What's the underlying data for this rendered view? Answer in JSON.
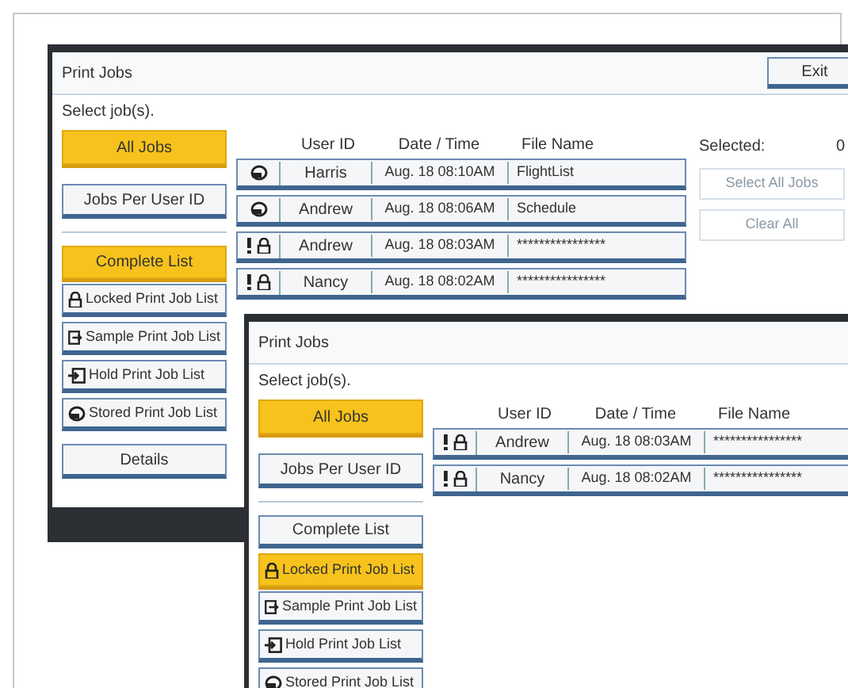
{
  "screens": [
    {
      "title": "Print Jobs",
      "exit": "Exit",
      "prompt": "Select job(s).",
      "view_buttons": [
        {
          "label": "All Jobs",
          "selected": true
        },
        {
          "label": "Jobs Per User ID",
          "selected": false
        }
      ],
      "list_buttons": [
        {
          "label": "Complete List",
          "kind": "plain",
          "selected": true
        },
        {
          "label": "Locked Print Job List",
          "kind": "locked",
          "selected": false
        },
        {
          "label": "Sample Print Job List",
          "kind": "sample",
          "selected": false
        },
        {
          "label": "Hold Print Job List",
          "kind": "hold",
          "selected": false
        },
        {
          "label": "Stored Print Job List",
          "kind": "stored",
          "selected": false
        }
      ],
      "details": "Details",
      "columns": [
        "User ID",
        "Date / Time",
        "File Name"
      ],
      "rows": [
        {
          "kind": "stored",
          "user": "Harris",
          "time": "Aug. 18 08:10AM",
          "file": "FlightList"
        },
        {
          "kind": "stored",
          "user": "Andrew",
          "time": "Aug. 18 08:06AM",
          "file": "Schedule"
        },
        {
          "kind": "locked",
          "user": "Andrew",
          "time": "Aug. 18 08:03AM",
          "file": "****************"
        },
        {
          "kind": "locked",
          "user": "Nancy",
          "time": "Aug. 18 08:02AM",
          "file": "****************"
        }
      ],
      "selected_label": "Selected:",
      "selected_count": "0",
      "actions": [
        {
          "label": "Select All Jobs",
          "disabled": true
        },
        {
          "label": "Clear All",
          "disabled": true
        }
      ]
    },
    {
      "title": "Print Jobs",
      "prompt": "Select job(s).",
      "view_buttons": [
        {
          "label": "All Jobs",
          "selected": true
        },
        {
          "label": "Jobs Per User ID",
          "selected": false
        }
      ],
      "list_buttons": [
        {
          "label": "Complete List",
          "kind": "plain",
          "selected": false
        },
        {
          "label": "Locked Print Job List",
          "kind": "locked",
          "selected": true
        },
        {
          "label": "Sample Print Job List",
          "kind": "sample",
          "selected": false
        },
        {
          "label": "Hold Print Job List",
          "kind": "hold",
          "selected": false
        },
        {
          "label": "Stored Print Job List",
          "kind": "stored",
          "selected": false
        }
      ],
      "columns": [
        "User ID",
        "Date / Time",
        "File Name"
      ],
      "rows": [
        {
          "kind": "locked",
          "user": "Andrew",
          "time": "Aug. 18 08:03AM",
          "file": "****************"
        },
        {
          "kind": "locked",
          "user": "Nancy",
          "time": "Aug. 18 08:02AM",
          "file": "****************"
        }
      ]
    }
  ]
}
